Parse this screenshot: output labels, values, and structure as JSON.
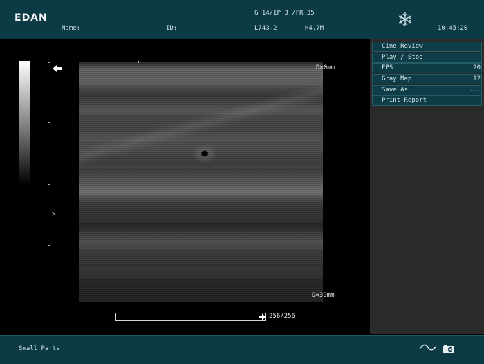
{
  "header": {
    "brand": "EDAN",
    "name_label": "Name:",
    "id_label": "ID:",
    "gain_info": "G 14/IP 3 /FR 35",
    "probe": "L743-2",
    "frequency": "H4.7M",
    "time": "10:45:20",
    "freeze_icon": "snowflake-icon"
  },
  "menu": {
    "items": [
      {
        "label": "Cine Review",
        "value": ""
      },
      {
        "label": "Play / Stop",
        "value": ""
      },
      {
        "label": "FPS",
        "value": "20"
      },
      {
        "label": "Gray Map",
        "value": "12"
      },
      {
        "label": "Save As",
        "value": "..."
      },
      {
        "label": "Print Report",
        "value": ""
      }
    ]
  },
  "image": {
    "depth_top": "D=0mm",
    "depth_bottom": "D=39mm",
    "focus_marker": ">",
    "orientation_icon": "arrow-left-icon"
  },
  "cine": {
    "frame_counter": "256/256",
    "position": 1.0
  },
  "footer": {
    "exam_preset": "Small Parts",
    "wave_icon": "wave-icon",
    "device_icon": "device-icon"
  },
  "colors": {
    "panel": "#0c3a45",
    "menu_item": "#0f3d47",
    "background": "#000000"
  }
}
